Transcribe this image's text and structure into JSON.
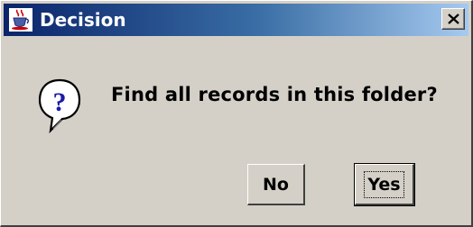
{
  "window": {
    "title": "Decision",
    "app_icon": "java-cup-icon",
    "close_icon": "close-icon"
  },
  "message": {
    "icon": "question-icon",
    "text": "Find all records in this folder?"
  },
  "buttons": {
    "no_label": "No",
    "yes_label": "Yes",
    "default": "Yes"
  },
  "colors": {
    "title_start": "#0a246a",
    "title_end": "#a6caf0",
    "dialog_bg": "#d4d0c8"
  }
}
